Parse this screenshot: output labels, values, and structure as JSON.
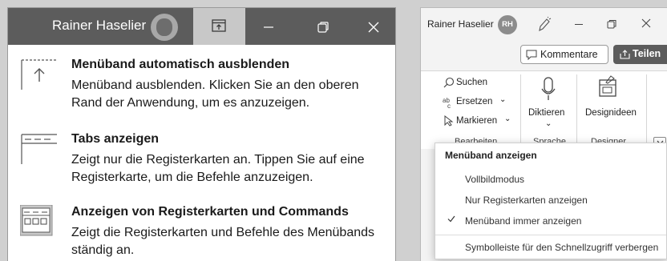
{
  "left_panel": {
    "user_name": "Rainer Haselier",
    "options": [
      {
        "title": "Menüband automatisch ausblenden",
        "description": "Menüband ausblenden. Klicken Sie an den oberen Rand der Anwendung, um es anzuzeigen.",
        "icon": "autohide-ribbon-icon"
      },
      {
        "title": "Tabs anzeigen",
        "description": "Zeigt nur die Registerkarten an. Tippen Sie auf eine Registerkarte, um die Befehle anzuzeigen.",
        "icon": "tabs-only-icon"
      },
      {
        "title": "Anzeigen von Registerkarten und Commands",
        "description": "Zeigt die Registerkarten und Befehle des Menübands ständig an.",
        "icon": "tabs-and-commands-icon"
      }
    ]
  },
  "right_panel": {
    "user_name": "Rainer Haselier",
    "avatar_initials": "RH",
    "comments_label": "Kommentare",
    "share_label": "Teilen",
    "ribbon": {
      "search_label": "Suchen",
      "replace_label": "Ersetzen",
      "select_label": "Markieren",
      "group_edit": "Bearbeiten",
      "dictate_label": "Diktieren",
      "group_voice": "Sprache",
      "designer_label": "Designideen",
      "group_designer": "Designer"
    },
    "menu": {
      "header": "Menüband anzeigen",
      "items": [
        "Vollbildmodus",
        "Nur Registerkarten anzeigen",
        "Menüband immer anzeigen",
        "Symbolleiste für den Schnellzugriff verbergen"
      ],
      "checked_index": 2
    }
  },
  "colors": {
    "titlebar": "#5c5c5c",
    "ribbon_display_button_bg": "#c8c8c8",
    "share_button": "#5c5c5c"
  }
}
